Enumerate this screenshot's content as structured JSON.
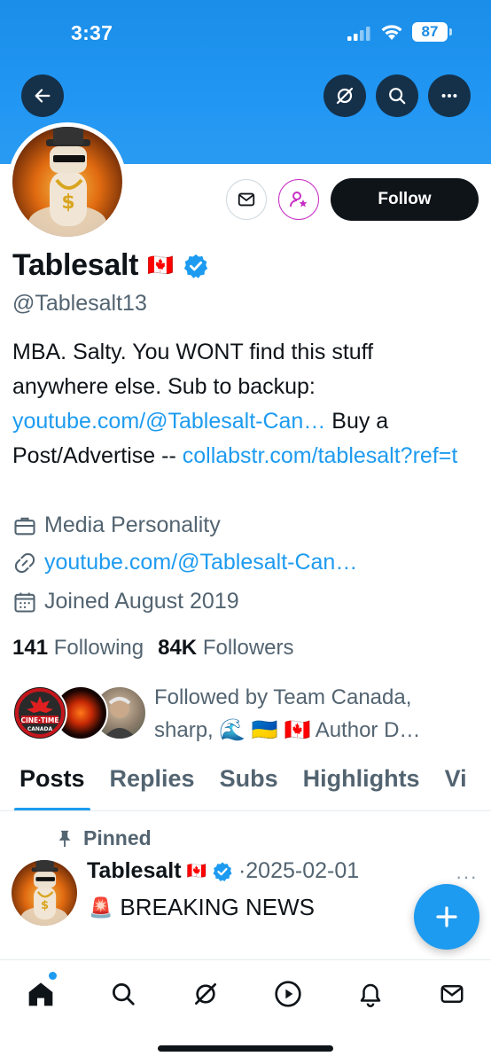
{
  "status_bar": {
    "time": "3:37",
    "battery": "87"
  },
  "profile": {
    "name": "Tablesalt",
    "flag": "🇨🇦",
    "handle": "@Tablesalt13",
    "follow_label": "Follow",
    "bio_text_1": "MBA. Salty. You WONT find this stuff anywhere else. Sub to backup: ",
    "bio_link_1": "youtube.com/@Tablesalt-Can…",
    "bio_text_2": " Buy a Post/Advertise -- ",
    "bio_link_2": "collabstr.com/​tablesalt?ref=t",
    "category": "Media Personality",
    "website": "youtube.com/@Tablesalt-Can…",
    "joined": "Joined August 2019",
    "following_count": "141",
    "following_label": "Following",
    "followers_count": "84K",
    "followers_label": "Followers",
    "followed_by_1": "Followed by Team Canada,",
    "followed_by_2": "sharp, 🌊 🇺🇦 🇨🇦 Author D…"
  },
  "tabs": [
    "Posts",
    "Replies",
    "Subs",
    "Highlights",
    "Vi"
  ],
  "pinned_post": {
    "pinned_label": "Pinned",
    "name": "Tablesalt",
    "flag": "🇨🇦",
    "date": "·2025-02-01",
    "more": "···",
    "siren": "🚨",
    "text": "BREAKING NEWS"
  },
  "colors": {
    "accent": "#1d9bf0",
    "banner": "#1f93ee",
    "subscribe": "#c72ec4"
  },
  "icons": [
    "back-arrow-icon",
    "grok-icon",
    "search-icon",
    "more-icon",
    "mail-icon",
    "subscribe-icon",
    "verified-icon",
    "briefcase-icon",
    "link-icon",
    "calendar-icon",
    "pin-icon",
    "plus-icon",
    "home-icon",
    "explore-icon",
    "play-icon",
    "bell-icon"
  ]
}
